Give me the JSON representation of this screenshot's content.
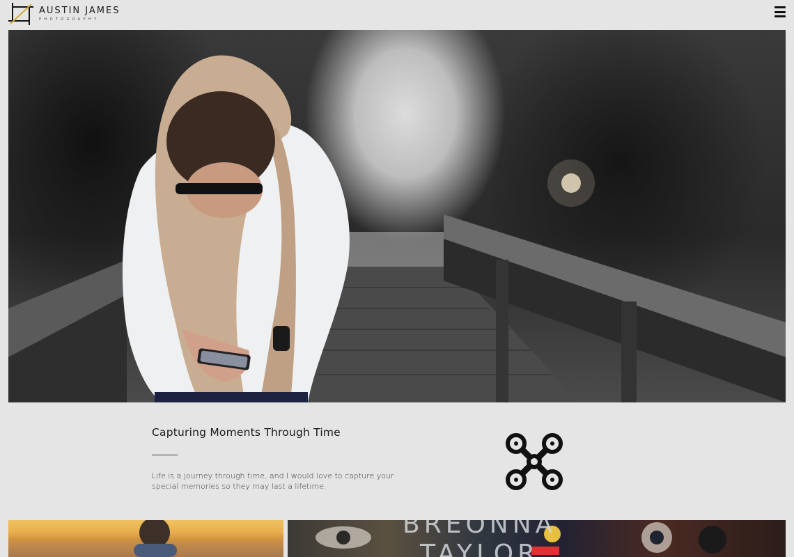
{
  "brand": {
    "name": "AUSTIN JAMES",
    "tagline": "PHOTOGRAPHY",
    "accent_color": "#d4a838"
  },
  "header": {
    "menu_icon": "hamburger-menu-icon"
  },
  "hero": {
    "image": "man-in-hoodie-on-boardwalk-photo"
  },
  "intro": {
    "title": "Capturing Moments Through Time",
    "text": "Life is a journey through time, and I would love to capture your special memories so they may last a lifetime.",
    "icon": "drone-icon"
  },
  "gallery": {
    "items": [
      {
        "image": "child-at-sunset-beach-photo"
      },
      {
        "image": "breonna-taylor-mural-photo",
        "mural_text_1": "BREONNA",
        "mural_text_2": "TAYLOR"
      }
    ]
  }
}
